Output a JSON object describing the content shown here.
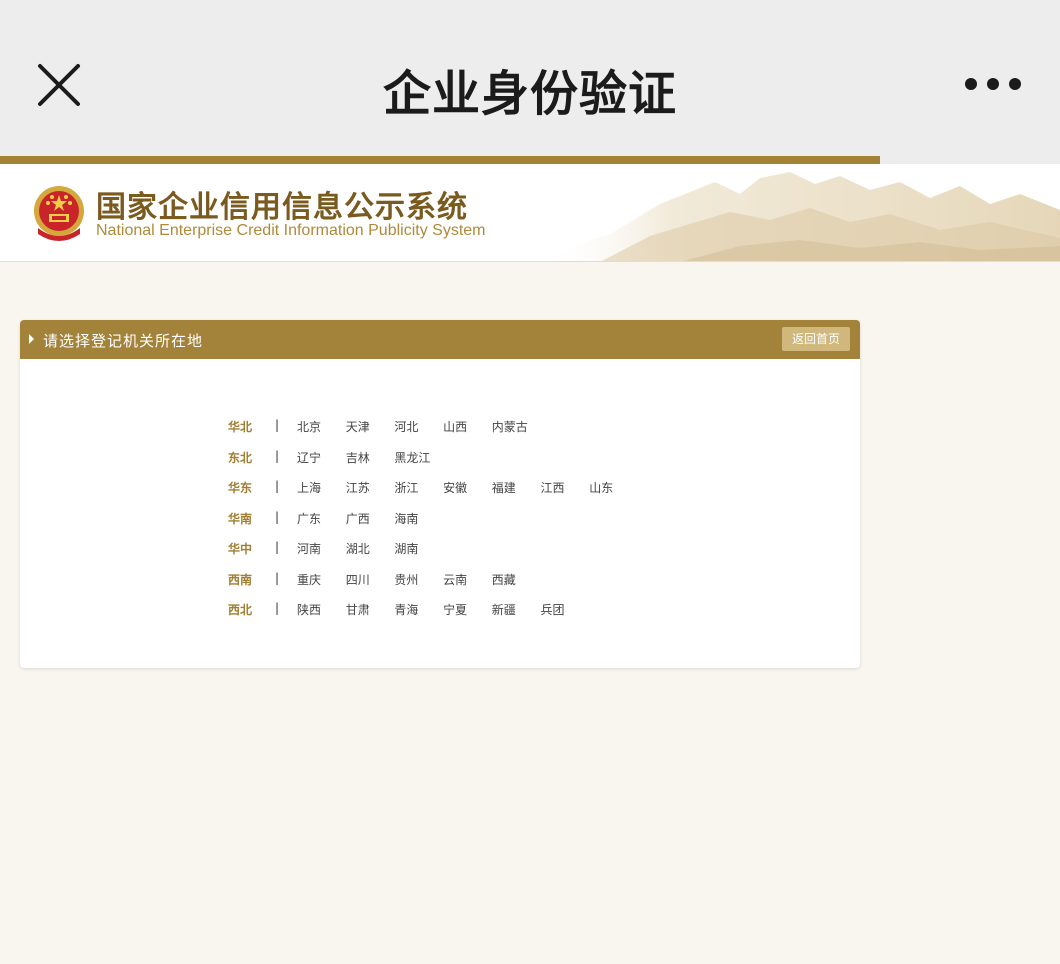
{
  "topbar": {
    "title": "企业身份验证",
    "close_icon": "close-icon",
    "more_icon": "more-dots-icon"
  },
  "progress": {
    "value": 0.83,
    "color": "#a38234"
  },
  "site": {
    "title_cn": "国家企业信用信息公示系统",
    "title_en": "National Enterprise Credit Information Publicity System",
    "emblem_icon": "national-emblem-icon"
  },
  "panel": {
    "title": "请选择登记机关所在地",
    "back_label": "返回首页",
    "accent": "#a38239"
  },
  "regions": [
    {
      "name": "华北",
      "provinces": [
        "北京",
        "天津",
        "河北",
        "山西",
        "内蒙古"
      ]
    },
    {
      "name": "东北",
      "provinces": [
        "辽宁",
        "吉林",
        "黑龙江"
      ]
    },
    {
      "name": "华东",
      "provinces": [
        "上海",
        "江苏",
        "浙江",
        "安徽",
        "福建",
        "江西",
        "山东"
      ]
    },
    {
      "name": "华南",
      "provinces": [
        "广东",
        "广西",
        "海南"
      ]
    },
    {
      "name": "华中",
      "provinces": [
        "河南",
        "湖北",
        "湖南"
      ]
    },
    {
      "name": "西南",
      "provinces": [
        "重庆",
        "四川",
        "贵州",
        "云南",
        "西藏"
      ]
    },
    {
      "name": "西北",
      "provinces": [
        "陕西",
        "甘肃",
        "青海",
        "宁夏",
        "新疆",
        "兵团"
      ]
    }
  ],
  "separator": "|"
}
